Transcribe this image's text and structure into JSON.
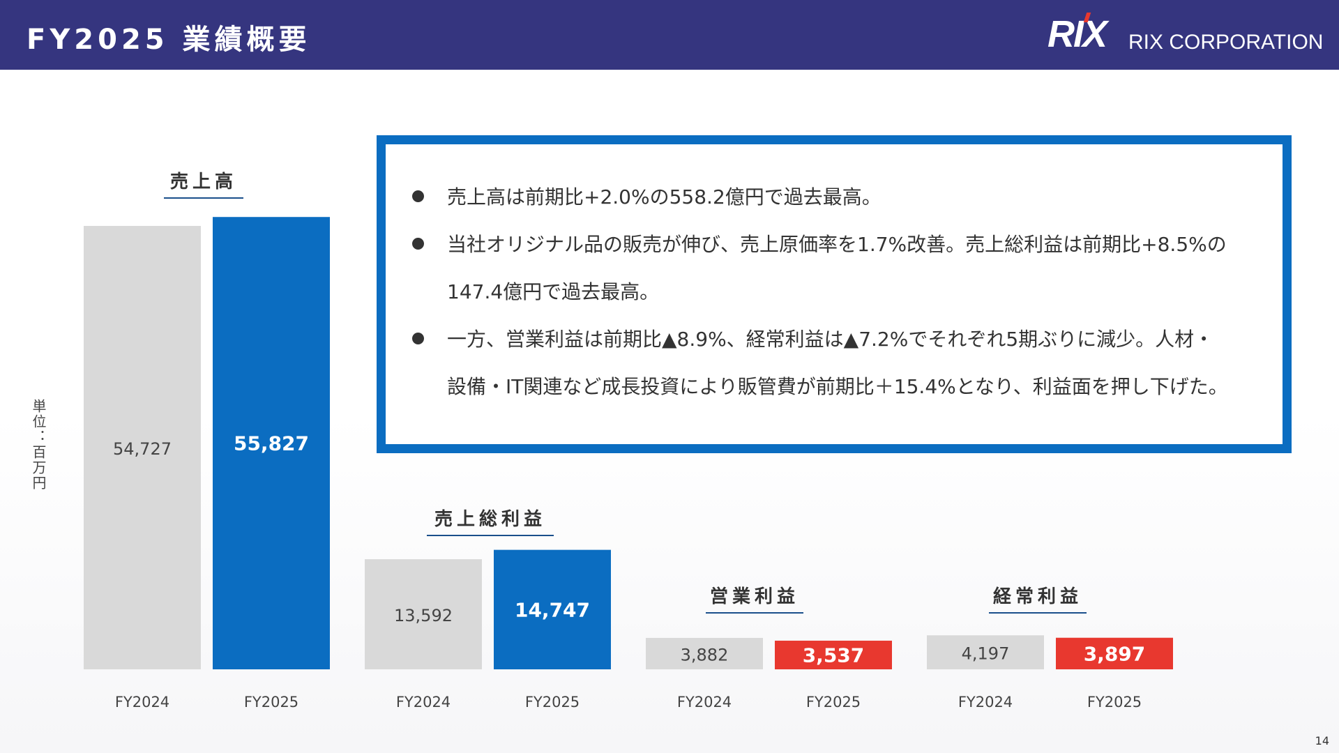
{
  "header": {
    "title": "FY2025 業績概要",
    "logo_mark": "RIX",
    "company": "RIX CORPORATION",
    "background": "#35357f"
  },
  "summary": {
    "bullets": [
      "売上高は前期比+2.0%の558.2億円で過去最高。",
      "当社オリジナル品の販売が伸び、売上原価率を1.7%改善。売上総利益は前期比+8.5%の\n147.4億円で過去最高。",
      "一方、営業利益は前期比▲8.9%、経常利益は▲7.2%でそれぞれ5期ぶりに減少。人材・\n設備・IT関連など成長投資により販管費が前期比＋15.4%となり、利益面を押し下げた。"
    ],
    "border_color": "#0b6dc1"
  },
  "unit_label": "単位：百万円",
  "page_number": "14",
  "colors": {
    "prior_year": "#d9d9d9",
    "growth": "#0b6dc1",
    "decline": "#e8382f"
  },
  "chart_data": [
    {
      "type": "bar",
      "title": "売上高",
      "categories": [
        "FY2024",
        "FY2025"
      ],
      "values": [
        54727,
        55827
      ],
      "labels": [
        "54,727",
        "55,827"
      ]
    },
    {
      "type": "bar",
      "title": "売上総利益",
      "categories": [
        "FY2024",
        "FY2025"
      ],
      "values": [
        13592,
        14747
      ],
      "labels": [
        "13,592",
        "14,747"
      ]
    },
    {
      "type": "bar",
      "title": "営業利益",
      "categories": [
        "FY2024",
        "FY2025"
      ],
      "values": [
        3882,
        3537
      ],
      "labels": [
        "3,882",
        "3,537"
      ]
    },
    {
      "type": "bar",
      "title": "経常利益",
      "categories": [
        "FY2024",
        "FY2025"
      ],
      "values": [
        4197,
        3897
      ],
      "labels": [
        "4,197",
        "3,897"
      ]
    }
  ]
}
